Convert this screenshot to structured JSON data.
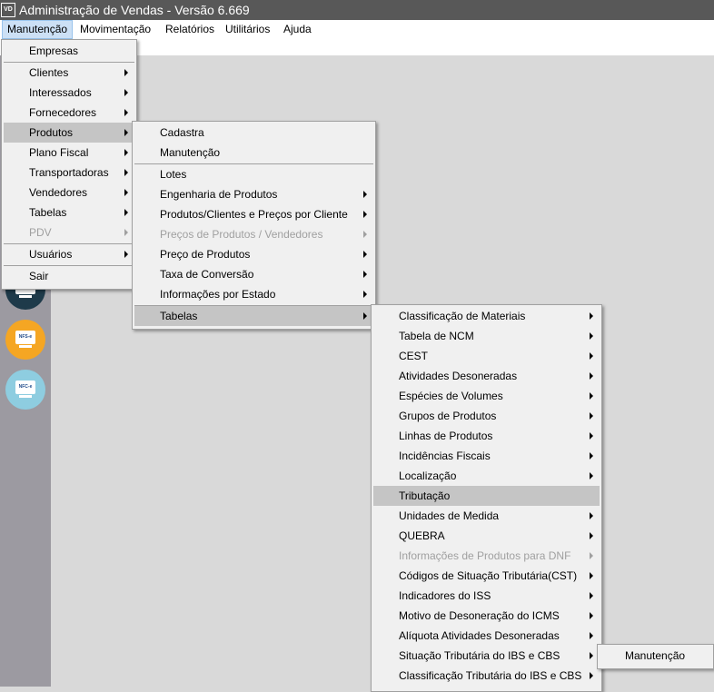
{
  "window": {
    "title": "Administração de Vendas - Versão 6.669",
    "logo": "VD"
  },
  "menubar": [
    "Manutenção",
    "Movimentação",
    "Relatórios",
    "Utilitários",
    "Ajuda"
  ],
  "sidebar": {
    "icon_labels": [
      "NFS-e",
      "NFC-e"
    ]
  },
  "menu1": {
    "items": [
      "Empresas",
      "Clientes",
      "Interessados",
      "Fornecedores",
      "Produtos",
      "Plano Fiscal",
      "Transportadoras",
      "Vendedores",
      "Tabelas",
      "PDV",
      "Usuários",
      "Sair"
    ],
    "highlighted": "Produtos",
    "disabled": [
      "PDV"
    ]
  },
  "menu2": {
    "items": [
      "Cadastra",
      "Manutenção",
      "Lotes",
      "Engenharia de Produtos",
      "Produtos/Clientes e Preços por Cliente",
      "Preços de Produtos / Vendedores",
      "Preço de Produtos",
      "Taxa de Conversão",
      "Informações por Estado",
      "Tabelas"
    ],
    "highlighted": "Tabelas",
    "disabled": [
      "Preços de Produtos / Vendedores"
    ]
  },
  "menu3": {
    "items": [
      "Classificação de Materiais",
      "Tabela de NCM",
      "CEST",
      "Atividades Desoneradas",
      "Espécies de Volumes",
      "Grupos de Produtos",
      "Linhas de Produtos",
      "Incidências Fiscais",
      "Localização",
      "Tributação",
      "Unidades de Medida",
      "QUEBRA",
      "Informações de Produtos para DNF",
      "Códigos de Situação Tributária(CST)",
      "Indicadores do ISS",
      "Motivo de Desoneração do ICMS",
      "Alíquota Atividades Desoneradas",
      "Situação Tributária do IBS e CBS",
      "Classificação Tributária do IBS e CBS"
    ],
    "highlighted": "Tributação",
    "disabled": [
      "Informações de Produtos para DNF"
    ]
  },
  "menu4": {
    "items": [
      "Manutenção"
    ]
  },
  "colors": {
    "titlebar": "#585858",
    "menu_bg": "#f0f0f0",
    "highlight": "#c5c5c5",
    "disabled_text": "#a0a0a0",
    "sidebar": "#9c9aa1"
  }
}
